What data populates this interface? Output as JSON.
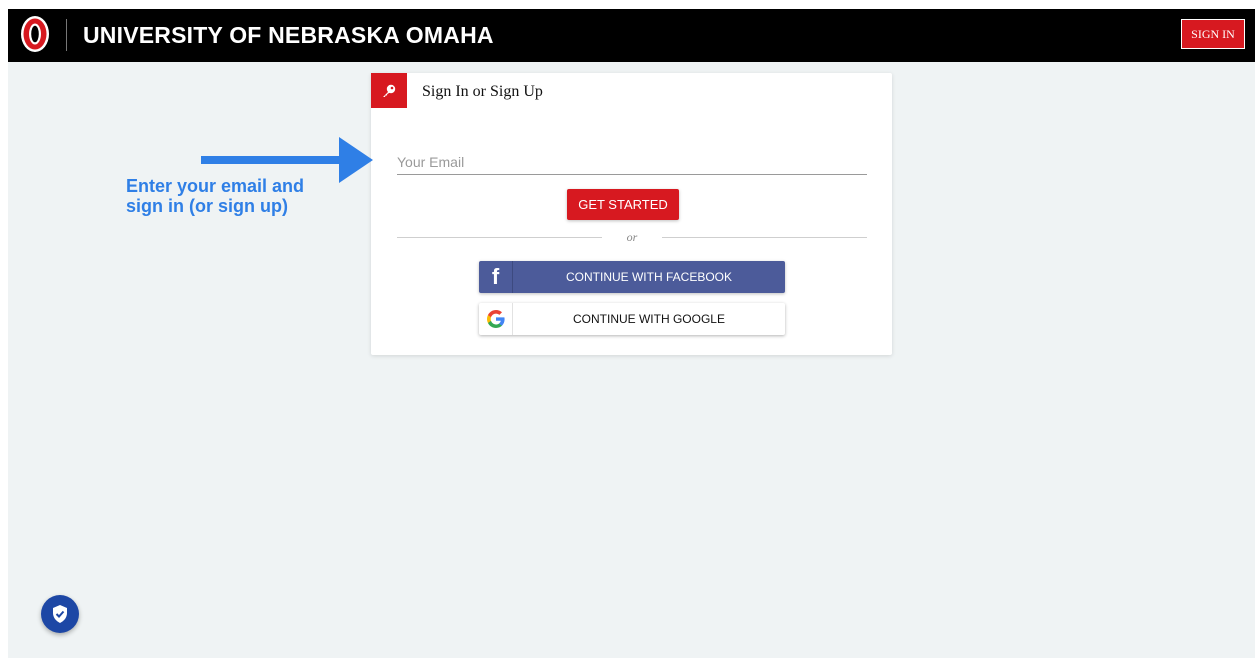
{
  "header": {
    "brand": "UNIVERSITY OF NEBRASKA OMAHA",
    "sign_in_label": "SIGN IN",
    "logo_icon": "unomaha-o-logo"
  },
  "card": {
    "title": "Sign In or Sign Up",
    "title_icon": "key-icon",
    "email_placeholder": "Your Email",
    "get_started_label": "GET STARTED",
    "divider_text": "or",
    "facebook_label": "CONTINUE WITH FACEBOOK",
    "google_label": "CONTINUE WITH GOOGLE"
  },
  "annotation": {
    "text": "Enter your email and sign in (or sign up)",
    "arrow_icon": "right-arrow-icon"
  },
  "floating": {
    "icon": "shield-check-icon"
  },
  "colors": {
    "brand_red": "#d71920",
    "facebook_blue": "#4c5b9a",
    "annotation_blue": "#2f7fe6",
    "page_bg": "#eff3f4",
    "fab_blue": "#1d47a5"
  }
}
